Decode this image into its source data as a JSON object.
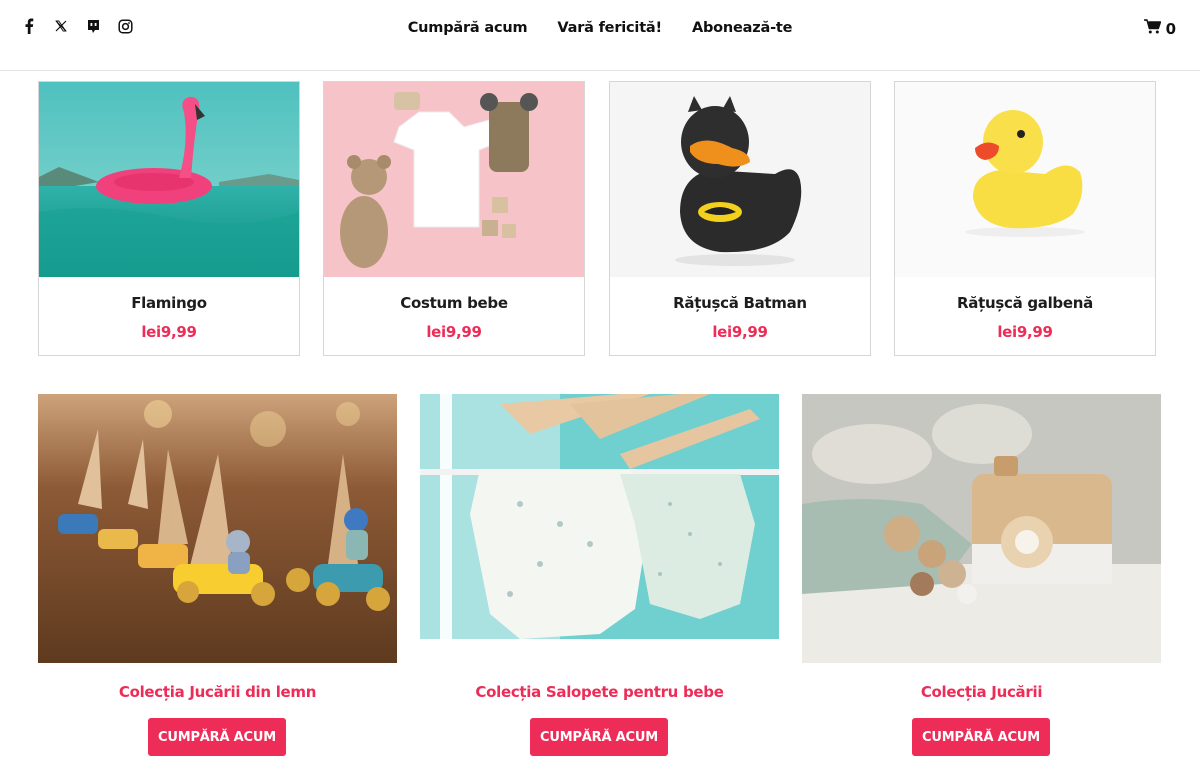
{
  "header": {
    "social": [
      {
        "icon": "facebook-icon"
      },
      {
        "icon": "x-twitter-icon"
      },
      {
        "icon": "discord-icon"
      },
      {
        "icon": "instagram-icon"
      }
    ],
    "nav": [
      "Cumpără acum",
      "Vară fericită!",
      "Abonează-te"
    ],
    "cart_count": "0"
  },
  "products": [
    {
      "name": "Flamingo",
      "price": "lei9,99"
    },
    {
      "name": "Costum bebe",
      "price": "lei9,99"
    },
    {
      "name": "Rățușcă Batman",
      "price": "lei9,99"
    },
    {
      "name": "Rățușcă galbenă",
      "price": "lei9,99"
    }
  ],
  "collections": [
    {
      "title": "Colecția Jucării din lemn",
      "button": "CUMPĂRĂ ACUM"
    },
    {
      "title": "Colecția Salopete pentru bebe",
      "button": "CUMPĂRĂ ACUM"
    },
    {
      "title": "Colecția Jucării",
      "button": "CUMPĂRĂ ACUM"
    }
  ],
  "colors": {
    "accent": "#ed2c57",
    "text": "#1d1d1d"
  }
}
